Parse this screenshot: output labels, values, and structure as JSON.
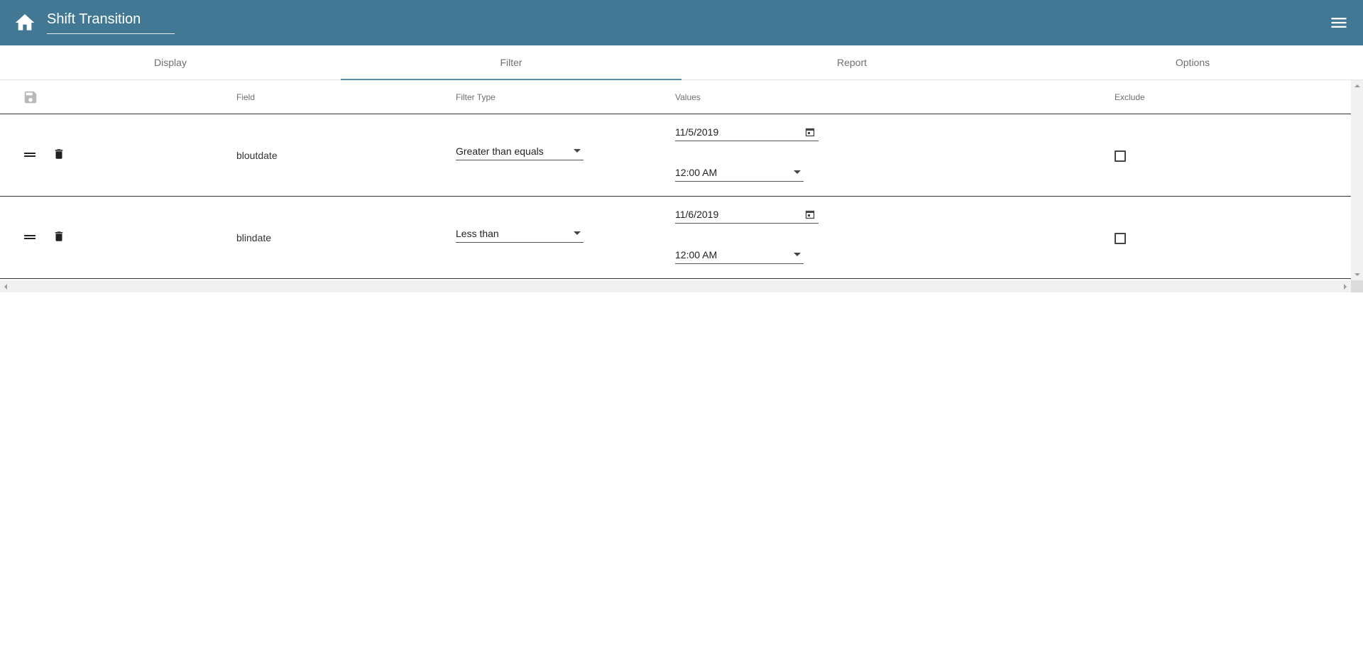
{
  "app": {
    "title": "Shift Transition"
  },
  "tabs": [
    {
      "label": "Display",
      "active": false
    },
    {
      "label": "Filter",
      "active": true
    },
    {
      "label": "Report",
      "active": false
    },
    {
      "label": "Options",
      "active": false
    }
  ],
  "grid": {
    "columns": {
      "field": "Field",
      "filter_type": "Filter Type",
      "values": "Values",
      "exclude": "Exclude"
    },
    "rows": [
      {
        "field": "bloutdate",
        "filter_type": "Greater than equals",
        "date": "11/5/2019",
        "time": "12:00 AM",
        "exclude": false
      },
      {
        "field": "blindate",
        "filter_type": "Less than",
        "date": "11/6/2019",
        "time": "12:00 AM",
        "exclude": false
      }
    ]
  },
  "icons": {
    "home": "home-icon",
    "menu": "hamburger-menu-icon",
    "save": "save-icon",
    "drag": "drag-handle-icon",
    "delete": "trash-icon",
    "calendar": "calendar-icon"
  },
  "colors": {
    "appbar": "#427893",
    "active_tab_indicator": "#5a8eaa"
  }
}
